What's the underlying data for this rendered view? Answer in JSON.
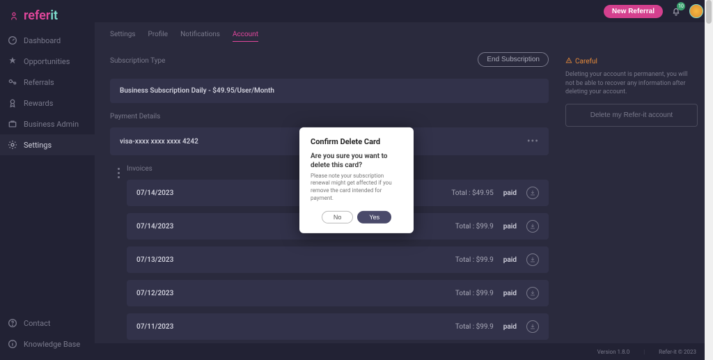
{
  "brand": {
    "name_a": "refer",
    "name_b": "it"
  },
  "topbar": {
    "new_referral": "New Referral",
    "notif_count": "10"
  },
  "sidebar": {
    "items": [
      {
        "label": "Dashboard"
      },
      {
        "label": "Opportunities"
      },
      {
        "label": "Referrals"
      },
      {
        "label": "Rewards"
      },
      {
        "label": "Business Admin"
      },
      {
        "label": "Settings"
      }
    ],
    "bottom": [
      {
        "label": "Contact"
      },
      {
        "label": "Knowledge Base"
      }
    ]
  },
  "tabs": {
    "label": "Settings",
    "items": [
      {
        "label": "Profile"
      },
      {
        "label": "Notifications"
      },
      {
        "label": "Account"
      }
    ],
    "active_index": 2
  },
  "subscription": {
    "title": "Subscription Type",
    "end_btn": "End Subscription",
    "plan": "Business Subscription Daily - $49.95/User/Month"
  },
  "payment": {
    "title": "Payment Details",
    "card": "visa-xxxx xxxx xxxx 4242"
  },
  "invoices": {
    "title": "Invoices",
    "total_prefix": "Total : ",
    "rows": [
      {
        "date": "07/14/2023",
        "total": "$49.95",
        "status": "paid"
      },
      {
        "date": "07/14/2023",
        "total": "$99.9",
        "status": "paid"
      },
      {
        "date": "07/13/2023",
        "total": "$99.9",
        "status": "paid"
      },
      {
        "date": "07/12/2023",
        "total": "$99.9",
        "status": "paid"
      },
      {
        "date": "07/11/2023",
        "total": "$99.9",
        "status": "paid"
      }
    ]
  },
  "danger": {
    "careful": "Careful",
    "text": "Deleting your account is permanent, you will not be able to recover any information after deleting your account.",
    "delete_btn": "Delete my Refer-it account"
  },
  "modal": {
    "title": "Confirm Delete Card",
    "question": "Are you sure you want to delete this card?",
    "note": "Please note your subscription renewal might get affected if you remove the card intended for payment.",
    "no": "No",
    "yes": "Yes"
  },
  "footer": {
    "version": "Version 1.8.0",
    "copyright": "Refer-it © 2023"
  }
}
